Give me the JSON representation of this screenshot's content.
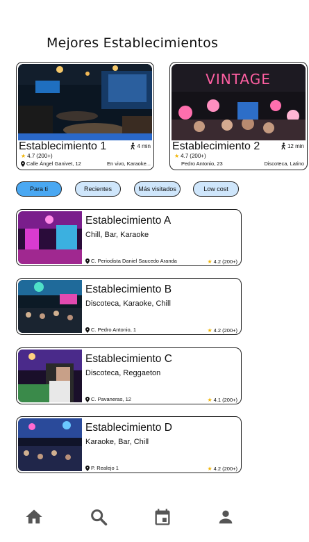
{
  "page_title": "Mejores Establecimientos",
  "featured": [
    {
      "name": "Establecimiento 1",
      "walk_time": "4 min",
      "rating": "4.7",
      "reviews": "(200+)",
      "address": "Calle Ángel Ganivet, 12",
      "tags": "En vivo, Karaoke..."
    },
    {
      "name": "Establecimiento 2",
      "walk_time": "12 min",
      "rating": "4.7",
      "reviews": "(200+)",
      "address": "Pedro Antonio, 23",
      "tags": "Discoteca, Latino",
      "sign_text": "VINTAGE"
    }
  ],
  "filters": [
    {
      "label": "Para ti",
      "active": true
    },
    {
      "label": "Recientes",
      "active": false
    },
    {
      "label": "Más visitados",
      "active": false
    },
    {
      "label": "Low cost",
      "active": false
    }
  ],
  "list": [
    {
      "name": "Establecimiento A",
      "categories": "Chill, Bar, Karaoke",
      "address": "C. Periodista Daniel Saucedo Aranda",
      "rating": "4.2",
      "reviews": "(200+)"
    },
    {
      "name": "Establecimiento B",
      "categories": "Discoteca, Karaoke, Chill",
      "address": "C. Pedro Antonio, 1",
      "rating": "4.2",
      "reviews": "(200+)"
    },
    {
      "name": "Establecimiento C",
      "categories": "Discoteca, Reggaeton",
      "address": "C. Pavaneras, 12",
      "rating": "4.1",
      "reviews": "(200+)"
    },
    {
      "name": "Establecimiento D",
      "categories": "Karaoke, Bar, Chill",
      "address": "P. Realejo 1",
      "rating": "4.2",
      "reviews": "(200+)"
    }
  ],
  "nav": [
    {
      "icon": "home-icon"
    },
    {
      "icon": "search-icon"
    },
    {
      "icon": "calendar-icon"
    },
    {
      "icon": "user-icon"
    }
  ],
  "colors": {
    "chip_active": "#4aa8f2",
    "chip_inactive": "#cfe6fb",
    "star": "#f2b400",
    "nav_icon": "#555555"
  }
}
